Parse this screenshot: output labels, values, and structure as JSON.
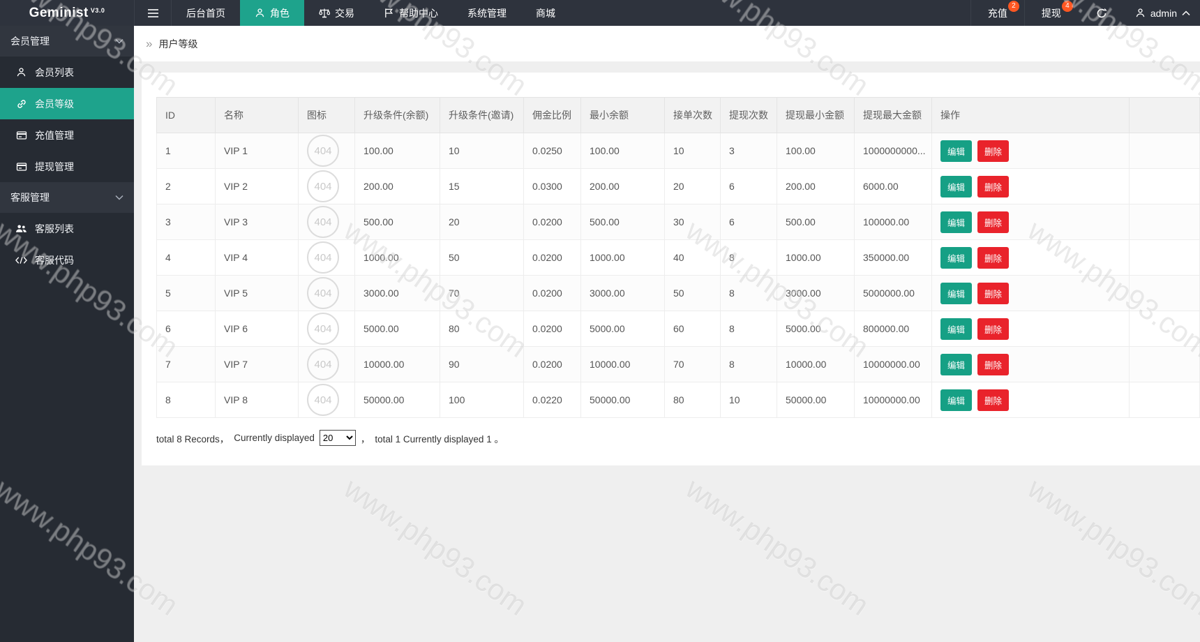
{
  "topbar": {
    "logo": "Geminist",
    "logo_version": "V3.0",
    "nav": [
      {
        "label": "后台首页",
        "icon": null,
        "active": false
      },
      {
        "label": "角色",
        "icon": "user",
        "active": true
      },
      {
        "label": "交易",
        "icon": "scale",
        "active": false
      },
      {
        "label": "帮助中心",
        "icon": "flag",
        "active": false
      },
      {
        "label": "系统管理",
        "icon": null,
        "active": false
      },
      {
        "label": "商城",
        "icon": null,
        "active": false
      }
    ],
    "actions": [
      {
        "label": "充值",
        "badge": "2"
      },
      {
        "label": "提现",
        "badge": "4"
      }
    ],
    "user": "admin"
  },
  "sidebar": {
    "sections": [
      {
        "title": "会员管理",
        "items": [
          {
            "label": "会员列表",
            "icon": "user",
            "active": false
          },
          {
            "label": "会员等级",
            "icon": "link",
            "active": true
          },
          {
            "label": "充值管理",
            "icon": "card",
            "active": false
          },
          {
            "label": "提现管理",
            "icon": "card",
            "active": false
          }
        ]
      },
      {
        "title": "客服管理",
        "items": [
          {
            "label": "客服列表",
            "icon": "users",
            "active": false
          },
          {
            "label": "客服代码",
            "icon": "code",
            "active": false
          }
        ]
      }
    ]
  },
  "breadcrumb": {
    "chevrons": "»",
    "label": "用户等级"
  },
  "table": {
    "columns": [
      "ID",
      "名称",
      "图标",
      "升级条件(余额)",
      "升级条件(邀请)",
      "佣金比例",
      "最小余额",
      "接单次数",
      "提现次数",
      "提现最小金额",
      "提现最大金额",
      "操作"
    ],
    "icon_placeholder": "404",
    "edit_label": "编辑",
    "delete_label": "删除",
    "rows": [
      {
        "id": "1",
        "name": "VIP 1",
        "upgrade_balance": "100.00",
        "upgrade_invite": "10",
        "commission": "0.0250",
        "min_balance": "100.00",
        "order_count": "10",
        "withdraw_count": "3",
        "withdraw_min": "100.00",
        "withdraw_max": "1000000000..."
      },
      {
        "id": "2",
        "name": "VIP 2",
        "upgrade_balance": "200.00",
        "upgrade_invite": "15",
        "commission": "0.0300",
        "min_balance": "200.00",
        "order_count": "20",
        "withdraw_count": "6",
        "withdraw_min": "200.00",
        "withdraw_max": "6000.00"
      },
      {
        "id": "3",
        "name": "VIP 3",
        "upgrade_balance": "500.00",
        "upgrade_invite": "20",
        "commission": "0.0200",
        "min_balance": "500.00",
        "order_count": "30",
        "withdraw_count": "6",
        "withdraw_min": "500.00",
        "withdraw_max": "100000.00"
      },
      {
        "id": "4",
        "name": "VIP 4",
        "upgrade_balance": "1000.00",
        "upgrade_invite": "50",
        "commission": "0.0200",
        "min_balance": "1000.00",
        "order_count": "40",
        "withdraw_count": "8",
        "withdraw_min": "1000.00",
        "withdraw_max": "350000.00"
      },
      {
        "id": "5",
        "name": "VIP 5",
        "upgrade_balance": "3000.00",
        "upgrade_invite": "70",
        "commission": "0.0200",
        "min_balance": "3000.00",
        "order_count": "50",
        "withdraw_count": "8",
        "withdraw_min": "3000.00",
        "withdraw_max": "5000000.00"
      },
      {
        "id": "6",
        "name": "VIP 6",
        "upgrade_balance": "5000.00",
        "upgrade_invite": "80",
        "commission": "0.0200",
        "min_balance": "5000.00",
        "order_count": "60",
        "withdraw_count": "8",
        "withdraw_min": "5000.00",
        "withdraw_max": "800000.00"
      },
      {
        "id": "7",
        "name": "VIP 7",
        "upgrade_balance": "10000.00",
        "upgrade_invite": "90",
        "commission": "0.0200",
        "min_balance": "10000.00",
        "order_count": "70",
        "withdraw_count": "8",
        "withdraw_min": "10000.00",
        "withdraw_max": "10000000.00"
      },
      {
        "id": "8",
        "name": "VIP 8",
        "upgrade_balance": "50000.00",
        "upgrade_invite": "100",
        "commission": "0.0220",
        "min_balance": "50000.00",
        "order_count": "80",
        "withdraw_count": "10",
        "withdraw_min": "50000.00",
        "withdraw_max": "10000000.00"
      }
    ]
  },
  "pagination": {
    "text_records": "total 8 Records，",
    "text_displayed": "Currently displayed",
    "page_size": "20",
    "text_separator": "，",
    "text_pages": "total 1 Currently displayed 1 。"
  },
  "watermark": {
    "text": "www.php93.com"
  },
  "colors": {
    "accent": "#1ea38c",
    "edit_button": "#16a085",
    "delete_button": "#e9232b",
    "badge": "#ff5722",
    "topbar": "#2e333d",
    "sidebar": "#262b33"
  }
}
